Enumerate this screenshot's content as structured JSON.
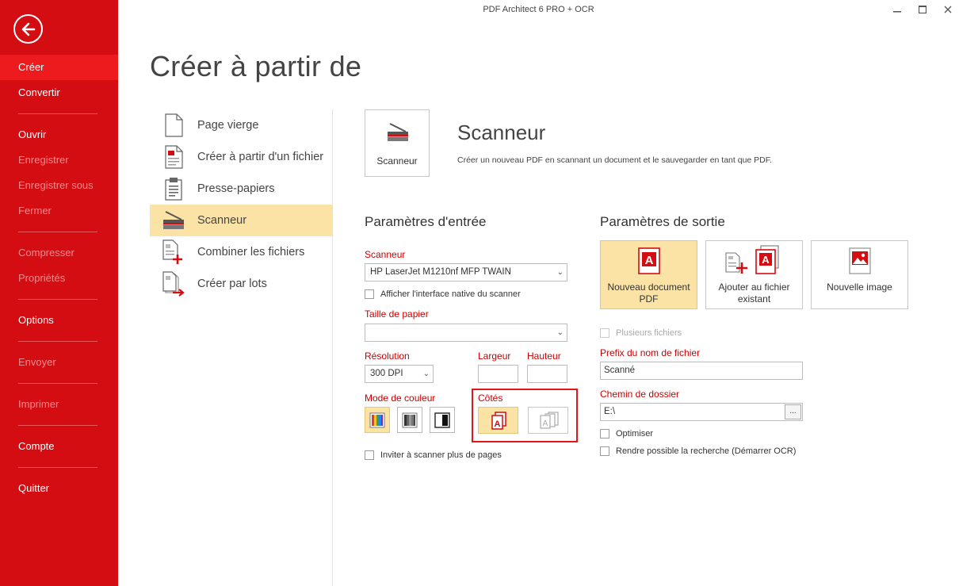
{
  "window": {
    "title": "PDF Architect 6 PRO + OCR"
  },
  "sidebar": {
    "items": [
      {
        "label": "Créer",
        "active": true
      },
      {
        "label": "Convertir"
      },
      {
        "label": "Ouvrir"
      },
      {
        "label": "Enregistrer",
        "disabled": true
      },
      {
        "label": "Enregistrer sous",
        "disabled": true
      },
      {
        "label": "Fermer",
        "disabled": true
      },
      {
        "label": "Compresser",
        "disabled": true
      },
      {
        "label": "Propriétés",
        "disabled": true
      },
      {
        "label": "Options"
      },
      {
        "label": "Envoyer",
        "disabled": true
      },
      {
        "label": "Imprimer",
        "disabled": true
      },
      {
        "label": "Compte"
      },
      {
        "label": "Quitter"
      }
    ]
  },
  "page": {
    "title": "Créer à partir de"
  },
  "sources": [
    {
      "label": "Page vierge",
      "icon": "blank-page-icon"
    },
    {
      "label": "Créer à partir d'un fichier",
      "icon": "pdf-file-icon"
    },
    {
      "label": "Presse-papiers",
      "icon": "clipboard-icon"
    },
    {
      "label": "Scanneur",
      "icon": "scanner-icon",
      "selected": true
    },
    {
      "label": "Combiner les fichiers",
      "icon": "combine-files-icon"
    },
    {
      "label": "Créer par lots",
      "icon": "batch-create-icon"
    }
  ],
  "scanner": {
    "tile_label": "Scanneur",
    "title": "Scanneur",
    "description": "Créer un nouveau PDF en scannant un document et le sauvegarder en tant que PDF."
  },
  "input": {
    "heading": "Paramètres d'entrée",
    "scanner_label": "Scanneur",
    "scanner_value": "HP LaserJet M1210nf MFP TWAIN",
    "native_ui_label": "Afficher l'interface native du scanner",
    "paper_label": "Taille de papier",
    "paper_value": "",
    "resolution_label": "Résolution",
    "resolution_value": "300 DPI",
    "width_label": "Largeur",
    "width_value": "",
    "height_label": "Hauteur",
    "height_value": "",
    "color_mode_label": "Mode de couleur",
    "sides_label": "Côtés",
    "more_pages_label": "Inviter à scanner plus de pages"
  },
  "output": {
    "heading": "Paramètres de sortie",
    "tiles": [
      {
        "line1": "Nouveau document",
        "line2": "PDF",
        "selected": true
      },
      {
        "line1": "Ajouter au fichier",
        "line2": "existant"
      },
      {
        "line1": "Nouvelle image",
        "line2": ""
      }
    ],
    "multiple_files_label": "Plusieurs fichiers",
    "prefix_label": "Prefix du nom de fichier",
    "prefix_value": "Scanné",
    "folder_label": "Chemin de dossier",
    "folder_value": "E:\\",
    "browse_label": "...",
    "optimize_label": "Optimiser",
    "ocr_label": "Rendre possible la recherche (Démarrer OCR)"
  },
  "colors": {
    "brand_red": "#d40d12",
    "selected_bg": "#fbe3a5",
    "label_red": "#cc0000"
  }
}
